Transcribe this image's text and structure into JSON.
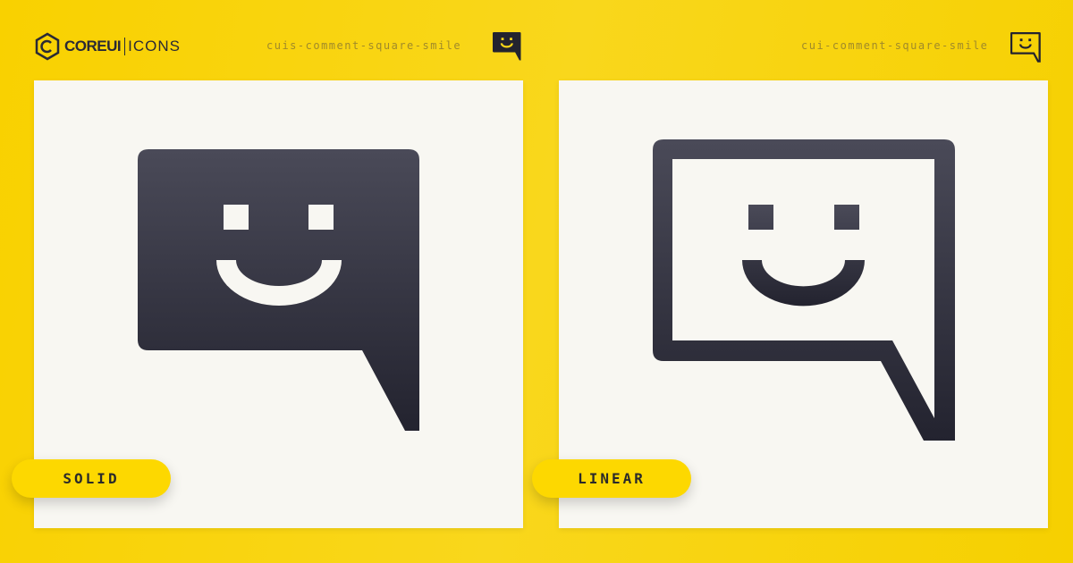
{
  "brand": {
    "strong": "COREUI",
    "light": "ICONS"
  },
  "solid": {
    "name": "cuis-comment-square-smile",
    "badge": "SOLID"
  },
  "linear": {
    "name": "cui-comment-square-smile",
    "badge": "LINEAR"
  },
  "colors": {
    "background": "#f9d100",
    "icon": "#2a2a38",
    "panel": "#f8f7f2",
    "badge": "#fdd800"
  }
}
